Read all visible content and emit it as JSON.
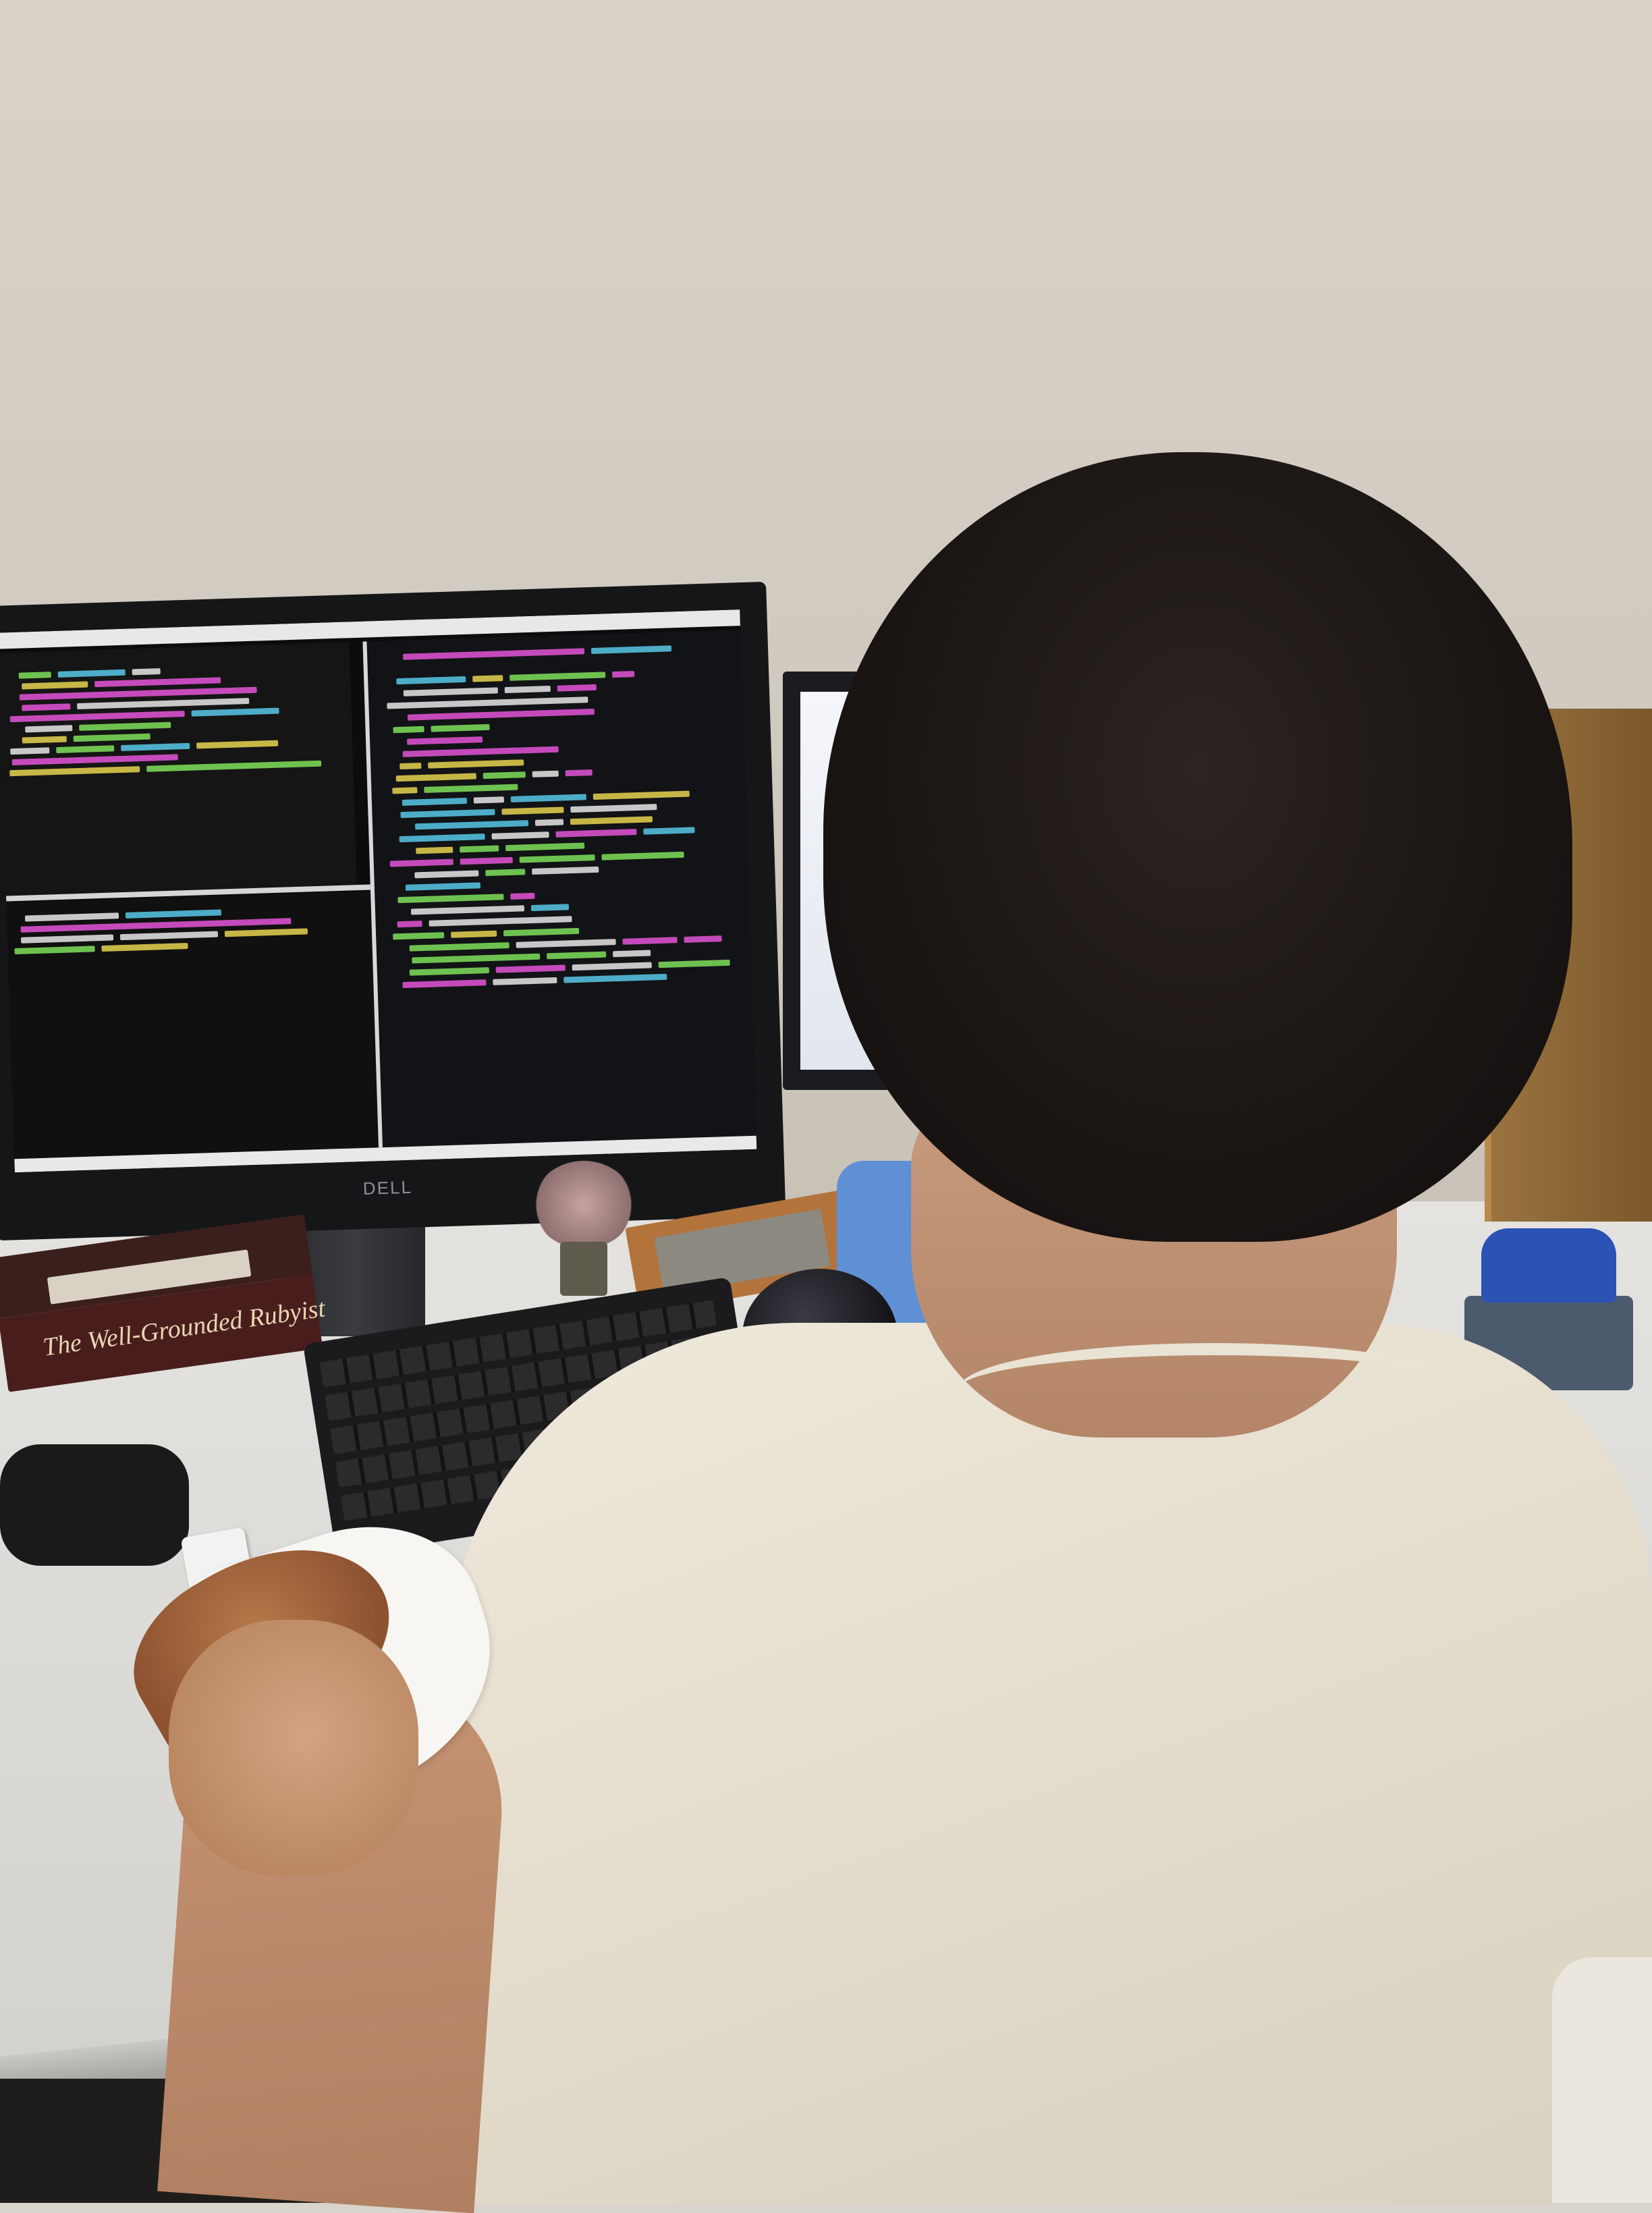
{
  "scene": {
    "monitor_brand": "DELL",
    "book_title": "The Well-Grounded Rubyist"
  },
  "colors": {
    "code_background": "#121316",
    "code_pink": "#e455d8",
    "code_green": "#7fe05a",
    "code_cyan": "#58c8e8",
    "code_yellow": "#e6d34f",
    "code_white": "#e8e8e8",
    "shirt": "#e9e3d4",
    "hair": "#1a1513",
    "bottle_cap": "#2b52b5"
  }
}
